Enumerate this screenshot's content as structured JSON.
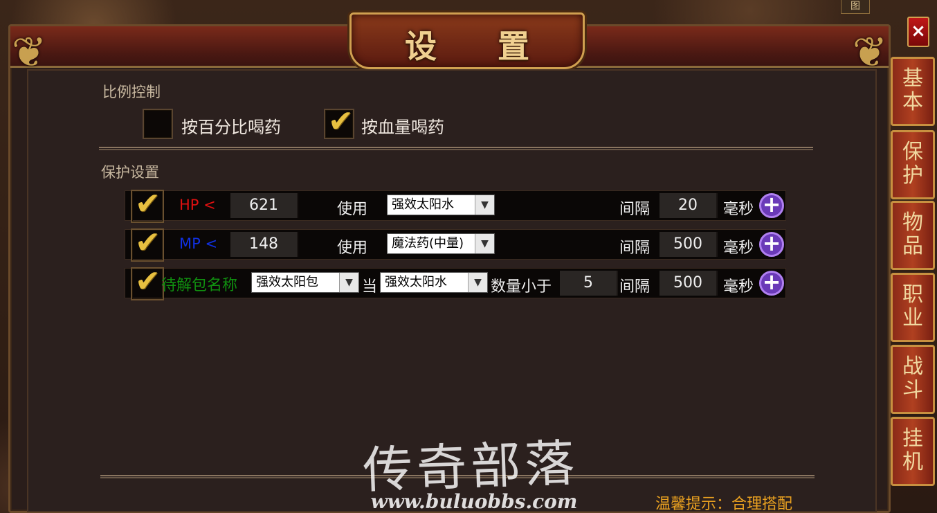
{
  "window": {
    "title": "设 置",
    "close_glyph": "×",
    "top_corner_label": "图"
  },
  "ratio_control": {
    "title": "比例控制",
    "options": [
      {
        "label": "按百分比喝药",
        "checked": false
      },
      {
        "label": "按血量喝药",
        "checked": true
      }
    ]
  },
  "protection": {
    "title": "保护设置",
    "rows": [
      {
        "checked": true,
        "stat_label": "HP <",
        "stat_color": "#e01010",
        "threshold": "621",
        "use_label": "使用",
        "item": "强效太阳水",
        "interval_label": "间隔",
        "interval": "20",
        "unit": "毫秒"
      },
      {
        "checked": true,
        "stat_label": "MP <",
        "stat_color": "#1030e0",
        "threshold": "148",
        "use_label": "使用",
        "item": "魔法药(中量)",
        "interval_label": "间隔",
        "interval": "500",
        "unit": "毫秒"
      },
      {
        "checked": true,
        "stat_label": "待解包名称",
        "stat_color": "#109010",
        "pack_item": "强效太阳包",
        "when_label": "当",
        "target_item": "强效太阳水",
        "count_label": "数量小于",
        "count": "5",
        "interval_label": "间隔",
        "interval": "500",
        "unit": "毫秒"
      }
    ]
  },
  "side_tabs": [
    {
      "line1": "基",
      "line2": "本"
    },
    {
      "line1": "保",
      "line2": "护"
    },
    {
      "line1": "物",
      "line2": "品"
    },
    {
      "line1": "职",
      "line2": "业"
    },
    {
      "line1": "战",
      "line2": "斗"
    },
    {
      "line1": "挂",
      "line2": "机"
    }
  ],
  "watermark": {
    "text": "传奇部落",
    "url": "www.buluobbs.com"
  },
  "hint": "温馨提示：合理搭配",
  "icons": {
    "checkmark": "✔",
    "dropdown": "▼",
    "plus": "+"
  },
  "colors": {
    "accent_gold": "#e8c040",
    "hint": "#e8a020",
    "plus_button": "#6a3ab8"
  }
}
